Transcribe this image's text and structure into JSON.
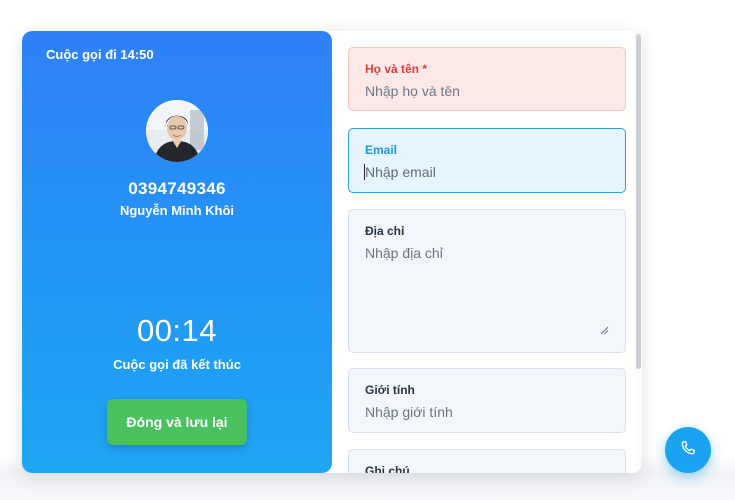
{
  "call": {
    "title": "Cuộc gọi đi 14:50",
    "phone": "0394749346",
    "name": "Nguyễn Minh Khôi",
    "timer": "00:14",
    "status": "Cuộc gọi đã kết thúc",
    "close_save_label": "Đóng và lưu lại",
    "accent": "#2f80f7",
    "button_color": "#49c15f"
  },
  "form": {
    "full_name": {
      "label": "Họ và tên",
      "required_mark": "*",
      "placeholder": "Nhập họ và tên"
    },
    "email": {
      "label": "Email",
      "placeholder": "Nhập email"
    },
    "address": {
      "label": "Địa chỉ",
      "placeholder": "Nhập địa chỉ"
    },
    "gender": {
      "label": "Giới tính",
      "placeholder": "Nhập giới tính"
    },
    "note": {
      "label": "Ghi chú"
    }
  },
  "icons": {
    "fab": "phone-icon",
    "avatar": "person-photo"
  }
}
